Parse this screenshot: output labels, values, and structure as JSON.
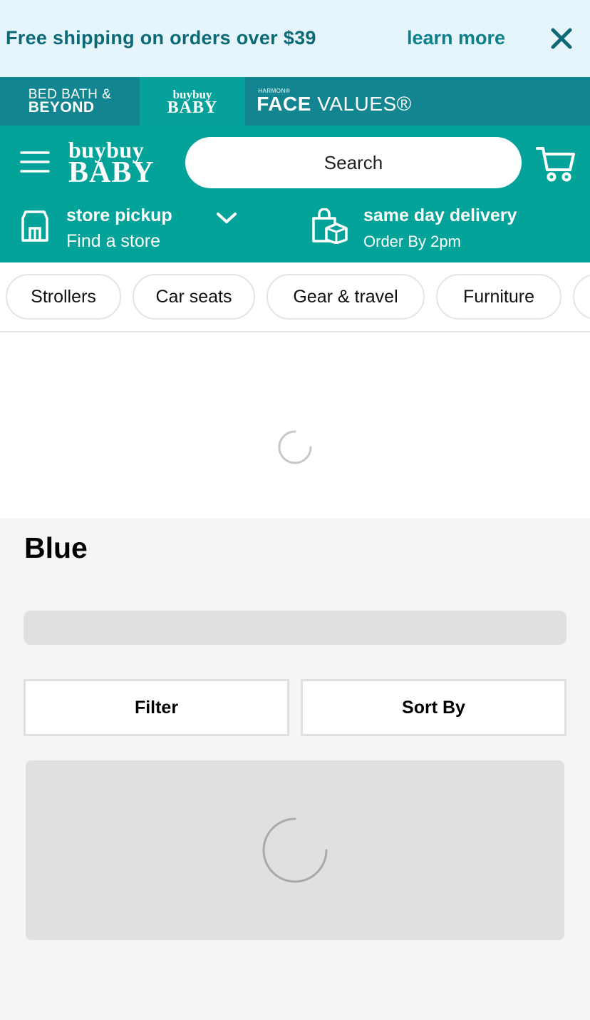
{
  "promo": {
    "text": "Free shipping on orders over $39",
    "link": "learn more"
  },
  "brands": {
    "bbb_line1": "BED BATH &",
    "bbb_line2": "BEYOND",
    "bb_line1": "buybuy",
    "bb_line2": "BABY",
    "fv_line1": "HARMON®",
    "fv_line2_bold": "FACE",
    "fv_line2_rest": " VALUES®"
  },
  "header": {
    "logo_line1": "buybuy",
    "logo_line2": "BABY",
    "search_placeholder": "Search"
  },
  "pickup": {
    "title": "store pickup",
    "subtitle": "Find a store"
  },
  "delivery": {
    "title": "same day delivery",
    "subtitle": "Order By 2pm"
  },
  "categories": [
    "Strollers",
    "Car seats",
    "Gear & travel",
    "Furniture",
    ""
  ],
  "page": {
    "title": "Blue",
    "filter_label": "Filter",
    "sort_label": "Sort By"
  },
  "colors": {
    "header": "#04a39a",
    "brand_bar": "#138590",
    "promo_bg": "#e6f4fb",
    "promo_text": "#0b6a75"
  }
}
